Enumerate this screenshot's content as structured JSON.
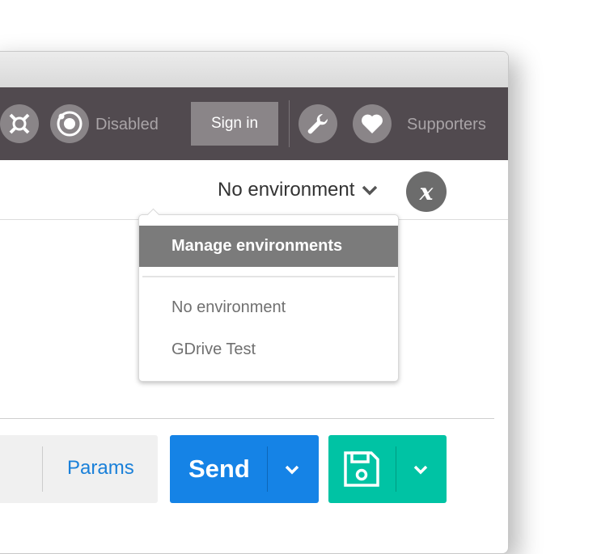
{
  "toolbar": {
    "disabled_label": "Disabled",
    "signin_label": "Sign in",
    "supporters_label": "Supporters",
    "icons": [
      "graphql-icon",
      "realtime-icon",
      "wrench-icon",
      "heart-icon"
    ]
  },
  "environment": {
    "selected": "No environment",
    "clear_icon_label": "x"
  },
  "env_menu": {
    "manage_label": "Manage environments",
    "items": [
      "No environment",
      "GDrive Test"
    ]
  },
  "request": {
    "params_label": "Params",
    "send_label": "Send"
  },
  "colors": {
    "toolbar_bg": "#514a4f",
    "send": "#1583e6",
    "save": "#00c3a4",
    "link": "#1a80d9"
  }
}
